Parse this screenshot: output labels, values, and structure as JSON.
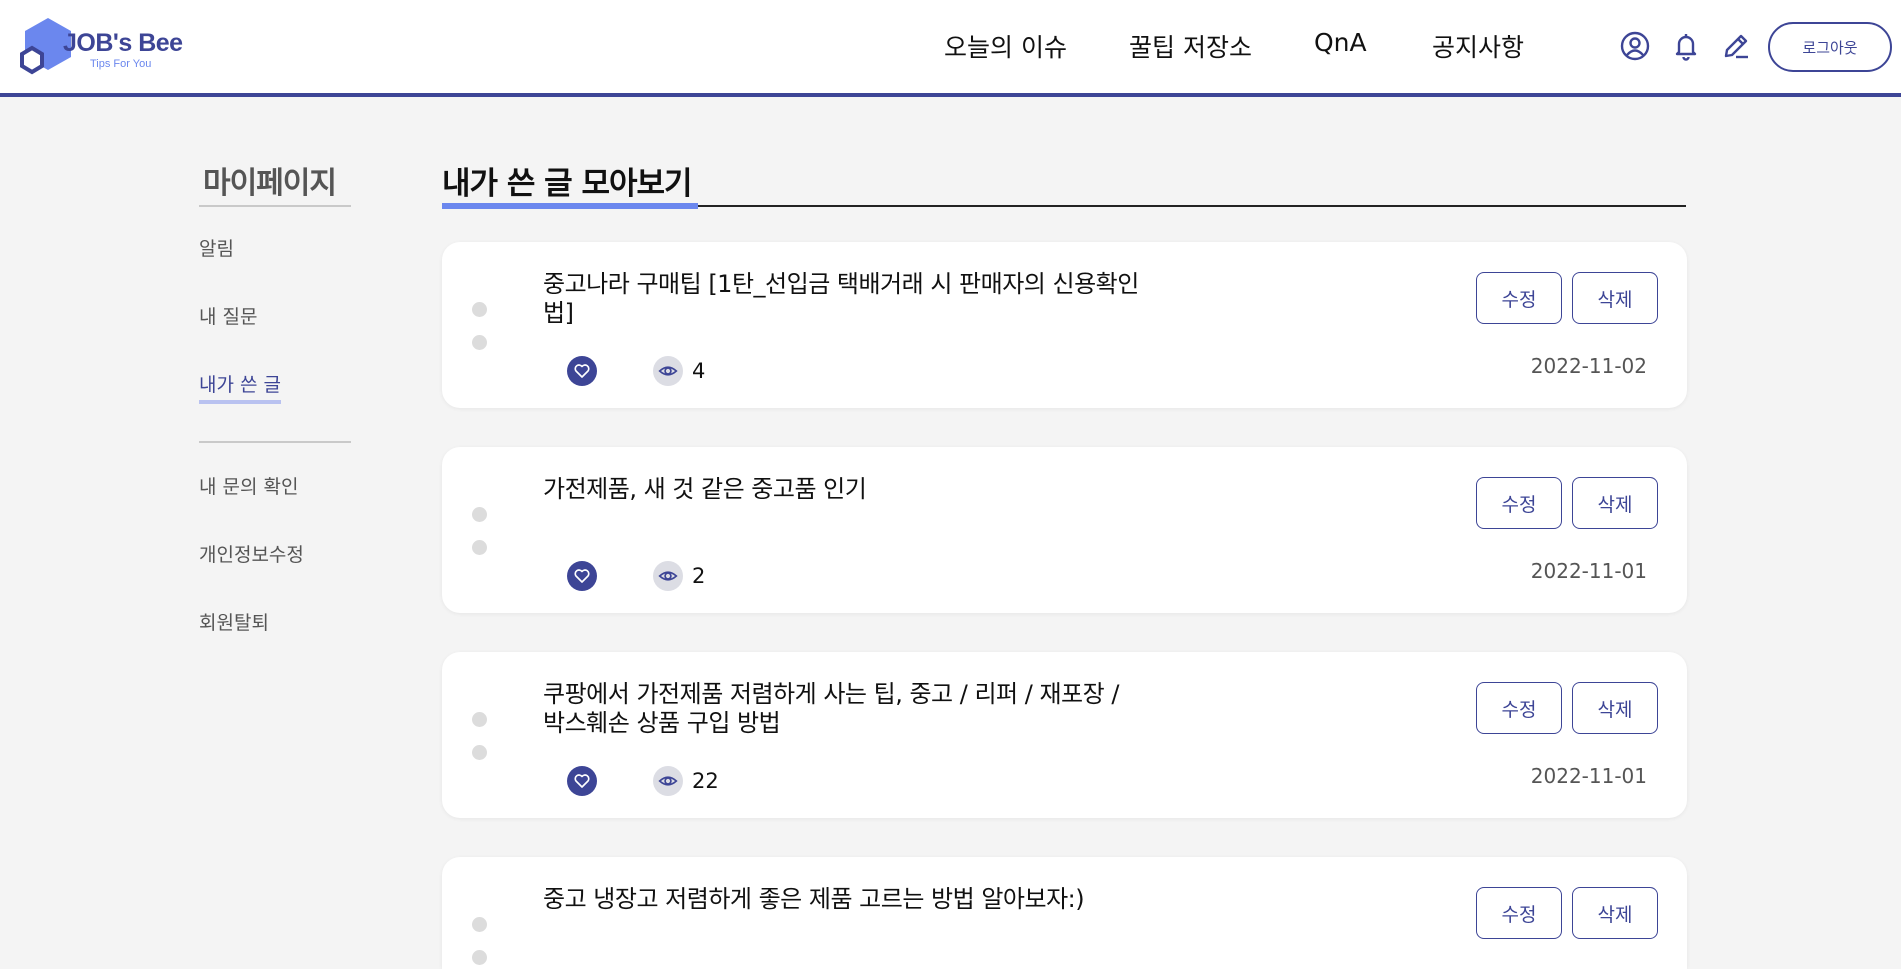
{
  "header": {
    "logo": {
      "brand": "JOB's Bee",
      "tagline": "Tips For You"
    },
    "nav": [
      "오늘의 이슈",
      "꿀팁 저장소",
      "QnA",
      "공지사항"
    ],
    "icons": [
      "user-icon",
      "bell-icon",
      "pencil-icon"
    ],
    "logout_label": "로그아웃"
  },
  "sidebar": {
    "title": "마이페이지",
    "group1": [
      "알림",
      "내 질문",
      "내가 쓴 글"
    ],
    "group2": [
      "내 문의 확인",
      "개인정보수정",
      "회원탈퇴"
    ],
    "active": "내가 쓴 글"
  },
  "main": {
    "title": "내가 쓴 글 모아보기",
    "posts": [
      {
        "title": "중고나라 구매팁 [1탄_선입금 택배거래 시 판매자의 신용확인법]",
        "views": "4",
        "date": "2022-11-02",
        "edit": "수정",
        "delete": "삭제"
      },
      {
        "title": "가전제품, 새 것 같은 중고품 인기",
        "views": "2",
        "date": "2022-11-01",
        "edit": "수정",
        "delete": "삭제"
      },
      {
        "title": "쿠팡에서 가전제품 저렴하게 사는 팁, 중고 / 리퍼 / 재포장 / 박스훼손 상품 구입 방법",
        "views": "22",
        "date": "2022-11-01",
        "edit": "수정",
        "delete": "삭제"
      },
      {
        "title": "중고 냉장고 저렴하게 좋은 제품 고르는 방법 알아보자:)",
        "views": "",
        "date": "",
        "edit": "수정",
        "delete": "삭제"
      }
    ]
  },
  "colors": {
    "primary": "#3d4596",
    "accent": "#6b87ee",
    "background": "#f4f4f4"
  }
}
